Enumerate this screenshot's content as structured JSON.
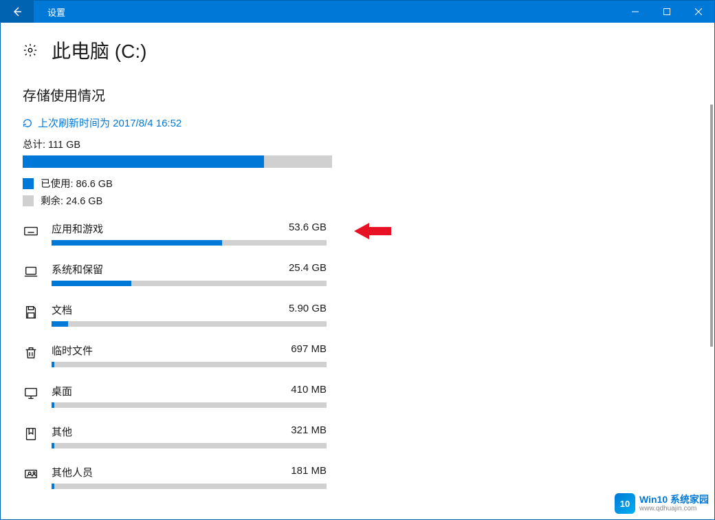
{
  "window": {
    "title": "设置"
  },
  "page": {
    "title": "此电脑 (C:)",
    "section_title": "存储使用情况",
    "refresh_label": "上次刷新时间为 2017/8/4 16:52",
    "total_label": "总计: 111 GB",
    "used_label": "已使用: 86.6 GB",
    "free_label": "剩余: 24.6 GB",
    "used_percent": 78
  },
  "categories": [
    {
      "name": "应用和游戏",
      "size": "53.6 GB",
      "percent": 62,
      "icon": "keyboard",
      "arrow": true
    },
    {
      "name": "系统和保留",
      "size": "25.4 GB",
      "percent": 29,
      "icon": "laptop"
    },
    {
      "name": "文档",
      "size": "5.90 GB",
      "percent": 6,
      "icon": "save"
    },
    {
      "name": "临时文件",
      "size": "697 MB",
      "percent": 1,
      "icon": "trash"
    },
    {
      "name": "桌面",
      "size": "410 MB",
      "percent": 1,
      "icon": "monitor"
    },
    {
      "name": "其他",
      "size": "321 MB",
      "percent": 1,
      "icon": "bookmark"
    },
    {
      "name": "其他人员",
      "size": "181 MB",
      "percent": 1,
      "icon": "people"
    }
  ],
  "watermark": {
    "line1": "Win10 系统家园",
    "line2": "www.qdhuajin.com",
    "badge": "10"
  }
}
